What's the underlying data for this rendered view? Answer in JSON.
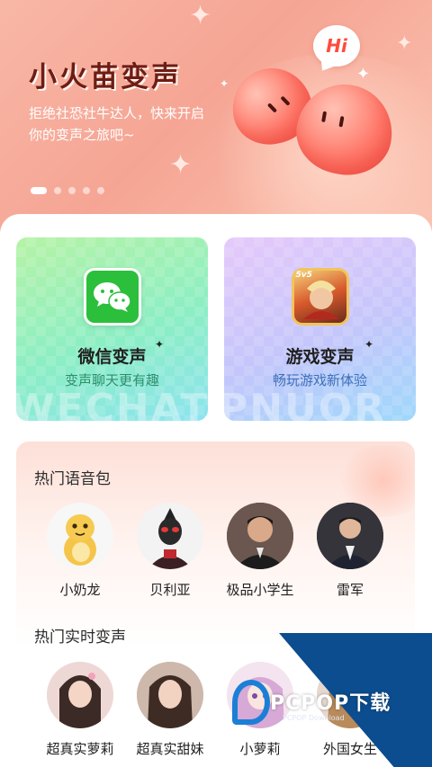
{
  "banner": {
    "title": "小火苗变声",
    "subtitle": "拒绝社恐社牛达人，快来开启你的变声之旅吧~",
    "bubble_text": "Hi",
    "page_count": 5,
    "active_page": 1
  },
  "features": [
    {
      "icon": "wechat-icon",
      "title": "微信变声",
      "subtitle": "变声聊天更有趣",
      "watermark": "WECHAT"
    },
    {
      "icon": "game-icon",
      "title": "游戏变声",
      "subtitle": "畅玩游戏新体验",
      "watermark": "PNUOR",
      "icon_badge": "5v5"
    }
  ],
  "hot_packs": {
    "title": "热门语音包",
    "items": [
      {
        "label": "小奶龙",
        "avatar": "dragon-avatar"
      },
      {
        "label": "贝利亚",
        "avatar": "ultraman-avatar"
      },
      {
        "label": "极品小学生",
        "avatar": "kid-avatar"
      },
      {
        "label": "雷军",
        "avatar": "man-avatar"
      }
    ]
  },
  "hot_realtime": {
    "title": "热门实时变声",
    "items": [
      {
        "label": "超真实萝莉",
        "avatar": "girl-avatar"
      },
      {
        "label": "超真实甜妹",
        "avatar": "woman-avatar"
      },
      {
        "label": "小萝莉",
        "avatar": "anime-girl-avatar"
      },
      {
        "label": "外国女生",
        "avatar": "foreign-girl-avatar"
      }
    ]
  },
  "watermark_badge": {
    "text": "PCPOP下载",
    "small_text": "PCPOP Download"
  },
  "colors": {
    "banner_bg": "#f6a594",
    "title": "#6e1d14",
    "badge_blue": "#0b4d8f"
  }
}
